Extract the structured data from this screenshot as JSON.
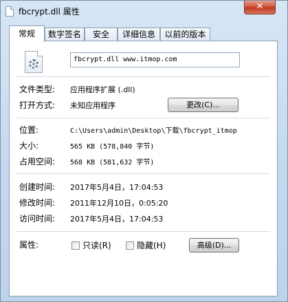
{
  "window": {
    "title": "fbcrypt.dll 属性",
    "close_glyph": "✕"
  },
  "tabs": [
    {
      "label": "常规",
      "active": true
    },
    {
      "label": "数字签名",
      "active": false
    },
    {
      "label": "安全",
      "active": false
    },
    {
      "label": "详细信息",
      "active": false
    },
    {
      "label": "以前的版本",
      "active": false
    }
  ],
  "general": {
    "file_name": "fbcrypt.dll www.itmop.com",
    "file_type_label": "文件类型:",
    "file_type_value": "应用程序扩展 (.dll)",
    "opens_with_label": "打开方式:",
    "opens_with_value": "未知应用程序",
    "change_button": "更改(C)...",
    "location_label": "位置:",
    "location_value": "C:\\Users\\admin\\Desktop\\下载\\fbcrypt_itmop",
    "size_label": "大小:",
    "size_value": "565 KB (578,840 字节)",
    "disk_size_label": "占用空间:",
    "disk_size_value": "568 KB (581,632 字节)",
    "created_label": "创建时间:",
    "created_value": "2017年5月4日，17:04:53",
    "modified_label": "修改时间:",
    "modified_value": "2011年12月10日，0:05:20",
    "accessed_label": "访问时间:",
    "accessed_value": "2017年5月4日，17:04:53",
    "attributes_label": "属性:",
    "readonly_label": "只读(R)",
    "readonly_checked": false,
    "hidden_label": "隐藏(H)",
    "hidden_checked": false,
    "advanced_button": "高级(D)..."
  }
}
